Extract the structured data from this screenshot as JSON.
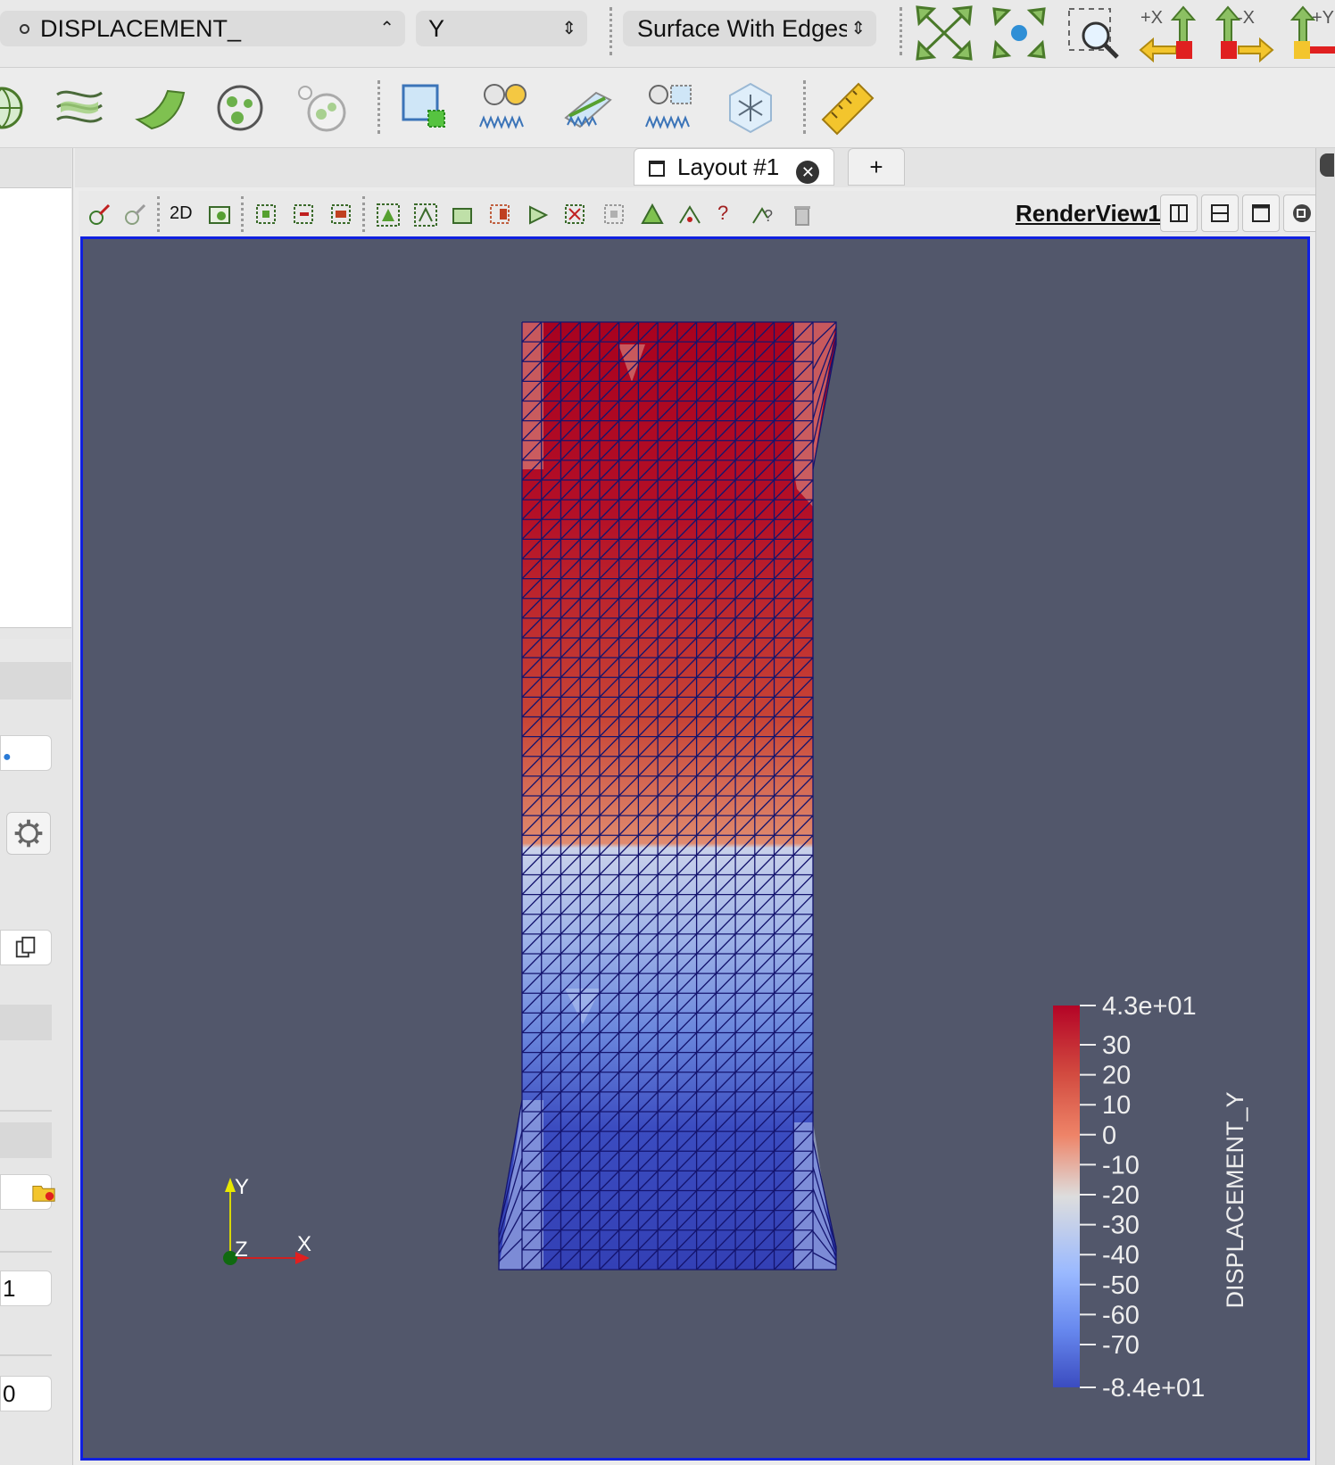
{
  "toolbar": {
    "array_name": "DISPLACEMENT_",
    "component": "Y",
    "representation": "Surface With Edges",
    "camera_labels": [
      "+X",
      "-X",
      "+Y"
    ]
  },
  "layout_tabs": {
    "tab_label": "Layout #1",
    "add_label": "+"
  },
  "render_toolbar": {
    "mode_2d": "2D",
    "query_label": "?",
    "view_title": "RenderView1"
  },
  "left_panel": {
    "field_a": "1",
    "field_b": "0"
  },
  "axes": {
    "x": "X",
    "y": "Y",
    "z": "Z"
  },
  "colorbar": {
    "title": "DISPLACEMENT_Y",
    "ticks": [
      "4.3e+01",
      "30",
      "20",
      "10",
      "0",
      "-10",
      "-20",
      "-30",
      "-40",
      "-50",
      "-60",
      "-70",
      "-8.4e+01"
    ],
    "range": [
      -84,
      43
    ],
    "colors": {
      "high": "#b40426",
      "mid": "#dddddd",
      "low": "#3b4cc0"
    }
  },
  "colors": {
    "background": "#52576b",
    "edge": "#14146e",
    "view_border": "#1020e0"
  }
}
